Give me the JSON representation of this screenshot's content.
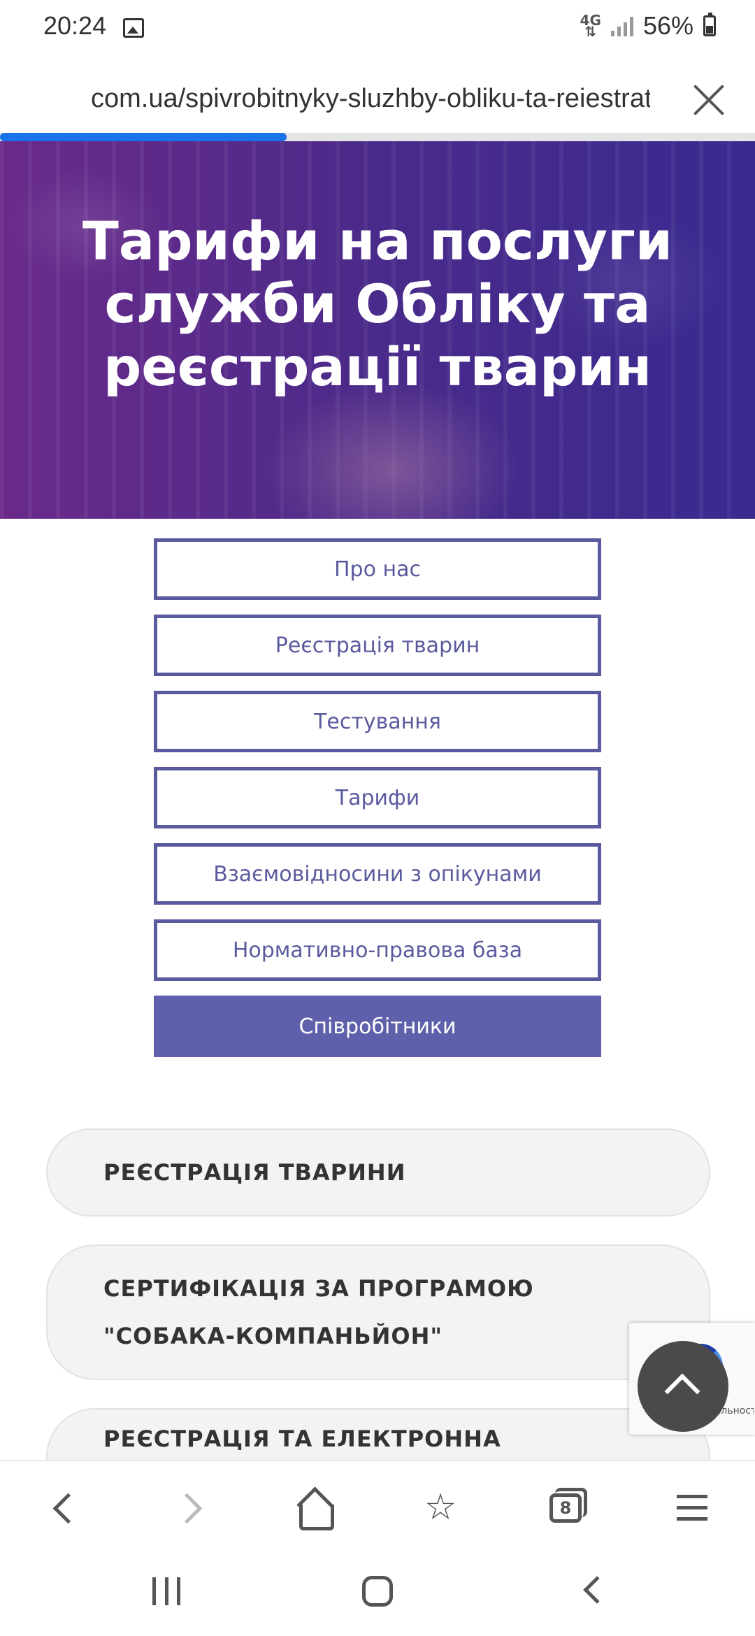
{
  "status_bar": {
    "time": "20:24",
    "network": "4G",
    "battery": "56%"
  },
  "browser": {
    "url": "com.ua/spivrobitnyky-sluzhby-obliku-ta-reiestratsii",
    "load_progress": 0.38,
    "tab_count": "8"
  },
  "hero": {
    "title": "Тарифи на послуги служби Обліку та реєстрації тварин"
  },
  "nav": {
    "items": [
      {
        "label": "Про нас",
        "active": false
      },
      {
        "label": "Реєстрація тварин",
        "active": false
      },
      {
        "label": "Тестування",
        "active": false
      },
      {
        "label": "Тарифи",
        "active": false
      },
      {
        "label": "Взаємовідносини з опікунами",
        "active": false
      },
      {
        "label": "Нормативно-правова база",
        "active": false
      },
      {
        "label": "Співробітники",
        "active": true
      }
    ]
  },
  "accordion": {
    "items": [
      {
        "label": "РЕЄСТРАЦІЯ ТВАРИНИ"
      },
      {
        "label": "СЕРТИФІКАЦІЯ ЗА ПРОГРАМОЮ \"СОБАКА-КОМПАНЬЙОН\""
      },
      {
        "label": "РЕЄСТРАЦІЯ ТА ЕЛЕКТРОННА ІДЕНТИФІКАЦІЯ"
      }
    ]
  },
  "recaptcha": {
    "text": "Конфиденциальность - Условия использования"
  },
  "colors": {
    "accent": "#5e60ab",
    "progress": "#1a73e8",
    "hero_bg": "#4a2a8a"
  }
}
